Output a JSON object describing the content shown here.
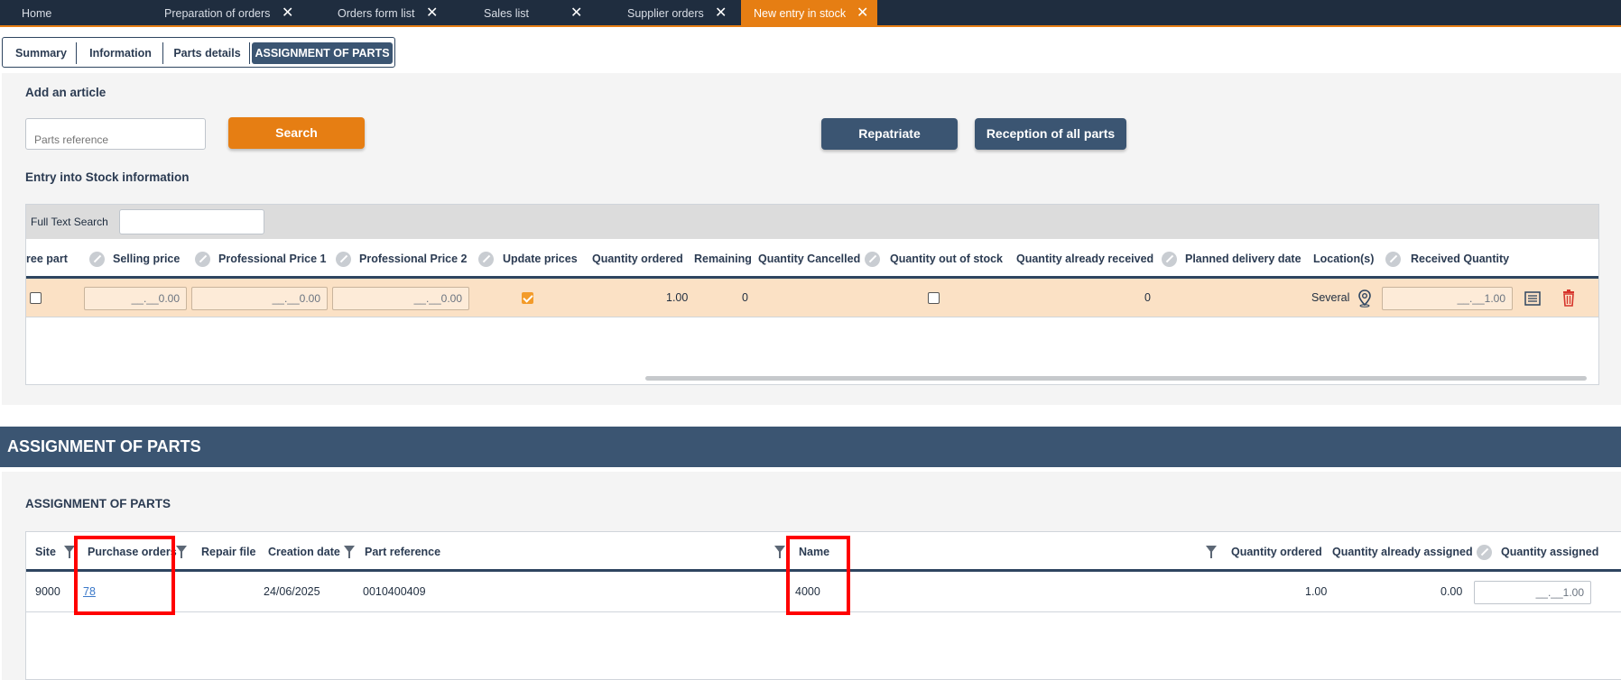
{
  "top_tabs": [
    {
      "label": "Home",
      "closable": false
    },
    {
      "label": "Preparation of orders",
      "closable": true
    },
    {
      "label": "Orders form list",
      "closable": true
    },
    {
      "label": "Sales list",
      "closable": true
    },
    {
      "label": "Supplier orders",
      "closable": true
    },
    {
      "label": "New entry in stock",
      "closable": true,
      "active": true
    }
  ],
  "close_glyph": "✕",
  "sub_tabs": [
    "Summary",
    "Information",
    "Parts details",
    "ASSIGNMENT OF PARTS"
  ],
  "add_article": {
    "heading": "Add an article",
    "parts_reference_placeholder": "Parts reference",
    "search_label": "Search",
    "repatriate_label": "Repatriate",
    "reception_label": "Reception of all parts"
  },
  "stock_info": {
    "heading": "Entry into Stock information",
    "full_text_search_label": "Full Text Search",
    "full_text_search_value": "",
    "columns": [
      "ree part",
      "Selling price",
      "Professional Price 1",
      "Professional Price 2",
      "Update prices",
      "Quantity ordered",
      "Remaining",
      "Quantity Cancelled",
      "Quantity out of stock",
      "Quantity already received",
      "Planned delivery date",
      "Location(s)",
      "Received Quantity"
    ],
    "row": {
      "free_part": false,
      "selling_price": "__.__0.00",
      "professional_price_1": "__.__0.00",
      "professional_price_2": "__.__0.00",
      "update_prices": true,
      "quantity_ordered": "1.00",
      "remaining": "0",
      "quantity_cancelled": "",
      "quantity_out_of_stock": false,
      "quantity_already_received": "0",
      "planned_delivery_date": "",
      "locations": "Several",
      "received_quantity": "__.__1.00"
    }
  },
  "section_title": "ASSIGNMENT OF PARTS",
  "assignment": {
    "heading": "ASSIGNMENT OF PARTS",
    "columns": [
      "Site",
      "Purchase orders",
      "Repair file",
      "Creation date",
      "Part reference",
      "Name",
      "Quantity ordered",
      "Quantity already assigned",
      "Quantity assigned"
    ],
    "rows": [
      {
        "site": "9000",
        "purchase_order": "78",
        "repair_file": "",
        "creation_date": "24/06/2025",
        "part_reference": "0010400409",
        "name": "4000",
        "quantity_ordered": "1.00",
        "quantity_already_assigned": "0.00",
        "quantity_assigned": "__.__1.00"
      }
    ]
  },
  "colors": {
    "navy": "#3b5572",
    "dark_bar": "#1f2d3f",
    "orange": "#e67e13",
    "row_highlight": "#fbe1c5",
    "annotation_red": "#ff0000"
  },
  "icons": [
    "filter-icon",
    "edit-icon",
    "location-pin-icon",
    "list-icon",
    "trash-icon",
    "close-icon"
  ]
}
